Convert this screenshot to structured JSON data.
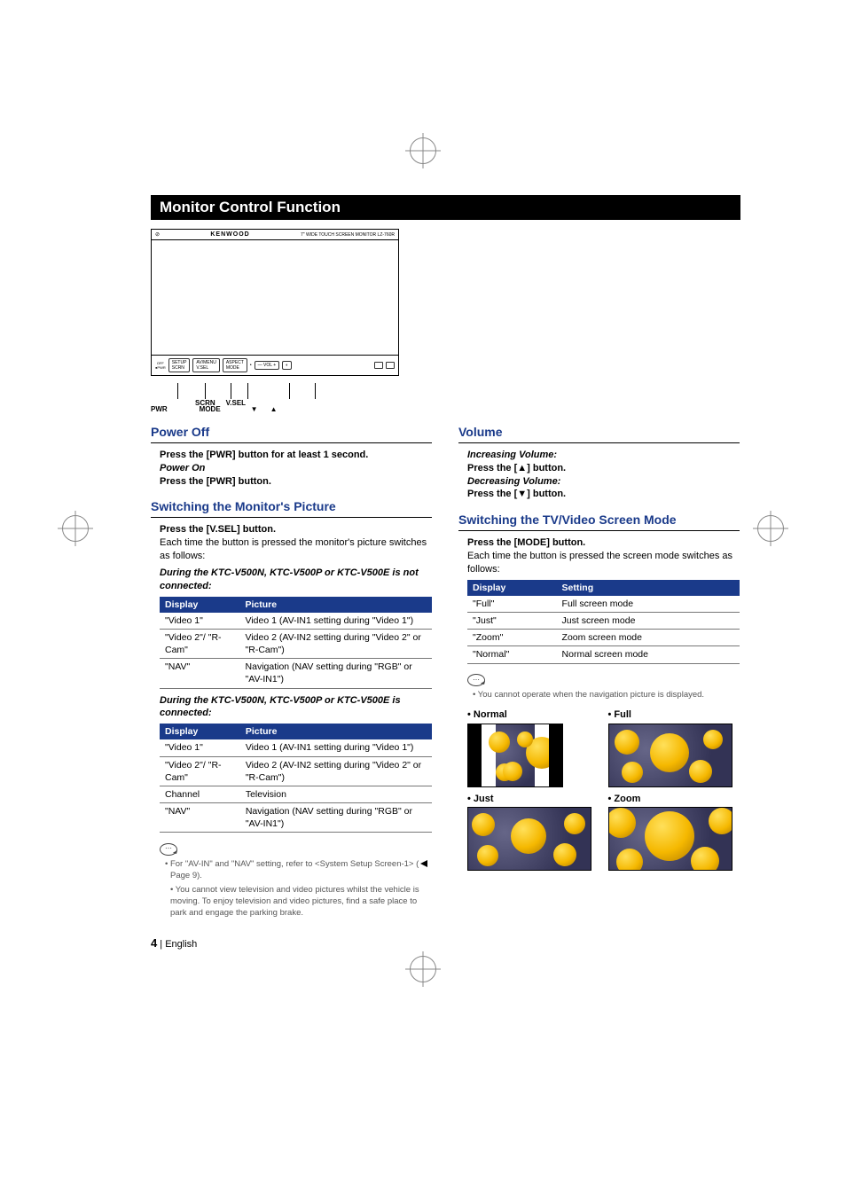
{
  "banner": "Monitor Control Function",
  "device": {
    "brand": "KENWOOD",
    "model": "7\" WIDE TOUCH SCREEN MONITOR LZ-760R",
    "btn_labels_top": {
      "scrn": "SCRN",
      "vsel": "V.SEL"
    },
    "btn_labels_bot": {
      "pwr": "PWR",
      "mode": "MODE",
      "down": "▼",
      "up": "▲"
    }
  },
  "power_off": {
    "title": "Power Off",
    "line1": "Press the [PWR] button for at least 1 second.",
    "power_on_h": "Power On",
    "line2": "Press the [PWR] button."
  },
  "switch_pic": {
    "title": "Switching the Monitor's Picture",
    "press": "Press the [V.SEL] button.",
    "desc": "Each time the button is pressed the monitor's picture switches as follows:",
    "sub_not": "During the KTC-V500N, KTC-V500P or KTC-V500E is not connected:",
    "sub_is": "During the KTC-V500N, KTC-V500P or KTC-V500E is connected:",
    "th_display": "Display",
    "th_picture": "Picture",
    "tbl_not": [
      {
        "d": "\"Video 1\"",
        "p": "Video 1 (AV-IN1 setting during \"Video 1\")"
      },
      {
        "d": "\"Video 2\"/ \"R-Cam\"",
        "p": "Video 2 (AV-IN2 setting during \"Video 2\" or \"R-Cam\")"
      },
      {
        "d": "\"NAV\"",
        "p": "Navigation (NAV setting during \"RGB\" or \"AV-IN1\")"
      }
    ],
    "tbl_is": [
      {
        "d": "\"Video 1\"",
        "p": "Video 1 (AV-IN1 setting during \"Video 1\")"
      },
      {
        "d": "\"Video 2\"/ \"R-Cam\"",
        "p": "Video 2 (AV-IN2 setting during \"Video 2\" or \"R-Cam\")"
      },
      {
        "d": "Channel",
        "p": "Television"
      },
      {
        "d": "\"NAV\"",
        "p": "Navigation (NAV setting during \"RGB\" or \"AV-IN1\")"
      }
    ],
    "note1a": "For \"AV-IN\" and \"NAV\" setting, refer to <System Setup Screen-1>  (",
    "note1b": " Page 9).",
    "note2": "You cannot view television and video pictures whilst the vehicle is moving. To enjoy television and video pictures, find a safe place to park and engage the parking brake."
  },
  "volume": {
    "title": "Volume",
    "inc_h": "Increasing Volume:",
    "inc_t": "Press the [▲] button.",
    "dec_h": "Decreasing Volume:",
    "dec_t": "Press the [▼] button."
  },
  "switch_mode": {
    "title": "Switching the TV/Video Screen Mode",
    "press": "Press the [MODE] button.",
    "desc": "Each time the button is pressed the screen mode switches as follows:",
    "th_display": "Display",
    "th_setting": "Setting",
    "rows": [
      {
        "d": "\"Full\"",
        "s": "Full screen mode"
      },
      {
        "d": "\"Just\"",
        "s": "Just screen mode"
      },
      {
        "d": "\"Zoom\"",
        "s": "Zoom screen mode"
      },
      {
        "d": "\"Normal\"",
        "s": "Normal screen mode"
      }
    ],
    "note": "You cannot operate when the navigation picture is displayed.",
    "modes": {
      "normal": "Normal",
      "full": "Full",
      "just": "Just",
      "zoom": "Zoom"
    }
  },
  "footer": {
    "num": "4",
    "sep": " |  ",
    "lang": "English"
  }
}
